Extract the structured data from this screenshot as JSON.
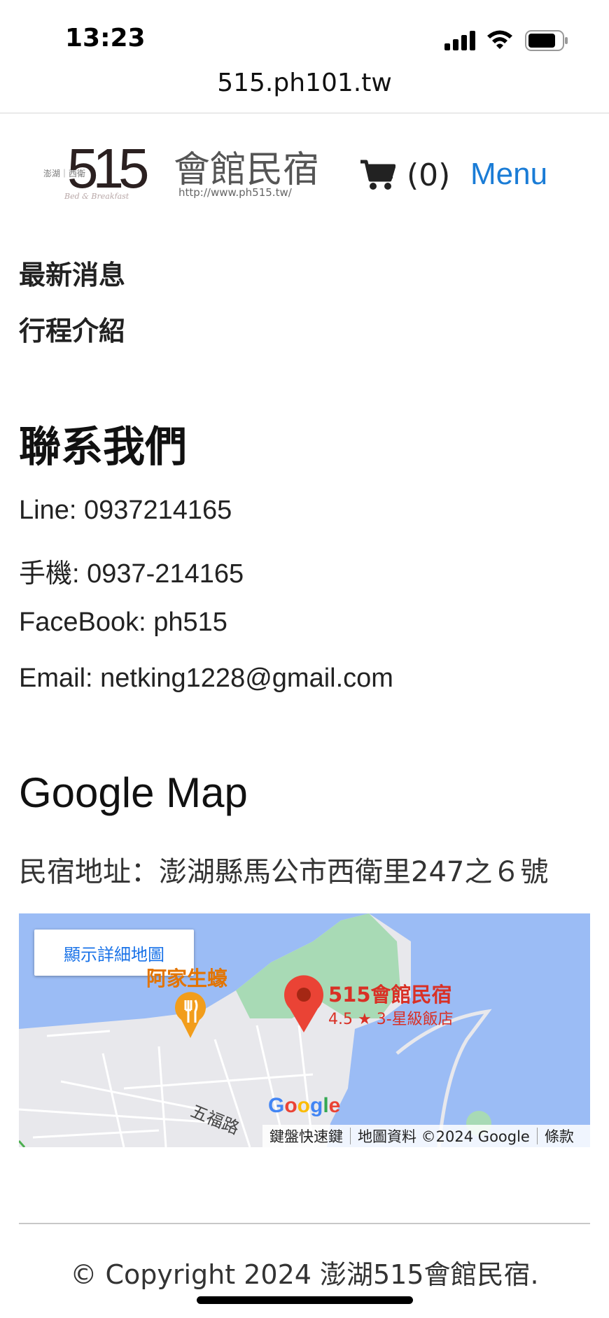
{
  "status_bar": {
    "time": "13:23"
  },
  "browser": {
    "url": "515.ph101.tw"
  },
  "header": {
    "logo": {
      "number": "515",
      "name": "會館民宿",
      "prefix": "澎湖｜西衛",
      "url": "http://www.ph515.tw/",
      "tagline": "Bed & Breakfast"
    },
    "cart_count": "(0)",
    "menu_label": "Menu",
    "accent_color": "#1a7cd6"
  },
  "nav": {
    "items": [
      "最新消息",
      "行程介紹"
    ]
  },
  "contact": {
    "title": "聯系我們",
    "line": "Line: 0937214165",
    "phone": "手機: 0937-214165",
    "facebook": "FaceBook: ph515",
    "email": "Email: netking1228@gmail.com"
  },
  "map_section": {
    "title": "Google Map",
    "address": "民宿地址：澎湖縣馬公市西衛里247之６號",
    "map": {
      "view_larger_button": "顯示詳細地圖",
      "place_name": "515會館民宿",
      "place_rating": "4.5 ★ 3-星級飯店",
      "poi_name": "阿家生蠔",
      "road_name": "五福路",
      "watermark": "Google",
      "footer": {
        "shortcuts": "鍵盤快速鍵",
        "map_data": "地圖資料 ©2024 Google",
        "terms": "條款"
      }
    }
  },
  "footer": {
    "copyright": "© Copyright 2024 澎湖515會館民宿."
  }
}
